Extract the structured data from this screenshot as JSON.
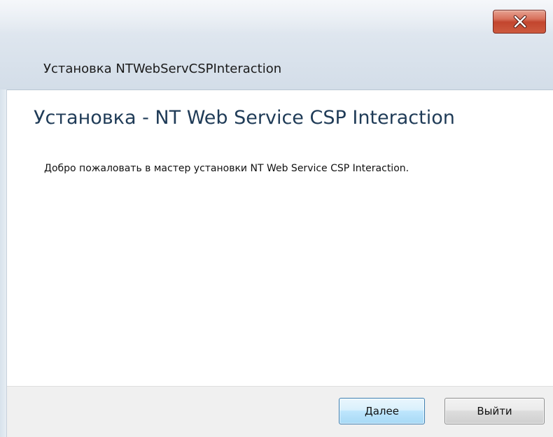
{
  "window": {
    "title": "Установка NTWebServCSPInteraction",
    "close_icon": "close-icon"
  },
  "main": {
    "heading": "Установка - NT Web Service CSP Interaction",
    "welcome_text": "Добро пожаловать в мастер установки NT Web Service CSP Interaction."
  },
  "footer": {
    "next_label": "Далее",
    "exit_label": "Выйти"
  },
  "colors": {
    "heading": "#1f3b57",
    "close_button": "#c2452e",
    "default_button_border": "#3c7fb1"
  }
}
